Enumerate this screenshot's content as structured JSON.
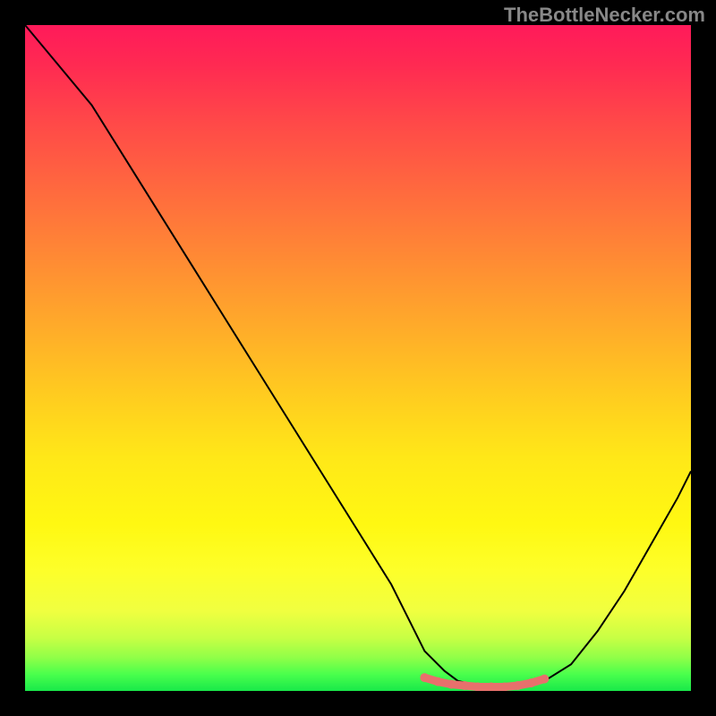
{
  "watermark": "TheBottleNecker.com",
  "chart_data": {
    "type": "line",
    "title": "",
    "xlabel": "",
    "ylabel": "",
    "xlim": [
      0,
      100
    ],
    "ylim": [
      0,
      100
    ],
    "series": [
      {
        "name": "bottleneck-curve",
        "x": [
          0,
          5,
          10,
          15,
          20,
          25,
          30,
          35,
          40,
          45,
          50,
          55,
          58,
          60,
          63,
          65,
          68,
          70,
          72,
          75,
          78,
          82,
          86,
          90,
          94,
          98,
          100
        ],
        "y": [
          100,
          94,
          88,
          80,
          72,
          64,
          56,
          48,
          40,
          32,
          24,
          16,
          10,
          6,
          3,
          1.5,
          0.8,
          0.6,
          0.6,
          0.8,
          1.5,
          4,
          9,
          15,
          22,
          29,
          33
        ]
      },
      {
        "name": "marker-band",
        "x": [
          60,
          62,
          64,
          66,
          68,
          70,
          72,
          74,
          76,
          78
        ],
        "y": [
          2.0,
          1.4,
          1.0,
          0.8,
          0.6,
          0.6,
          0.6,
          0.8,
          1.2,
          1.8
        ]
      }
    ],
    "gradient_stops": [
      {
        "pos": 0,
        "color": "#ff1a5a"
      },
      {
        "pos": 50,
        "color": "#ffca20"
      },
      {
        "pos": 85,
        "color": "#fdff2a"
      },
      {
        "pos": 100,
        "color": "#18e84a"
      }
    ],
    "marker_color": "#e8706c",
    "curve_color": "#000000"
  }
}
